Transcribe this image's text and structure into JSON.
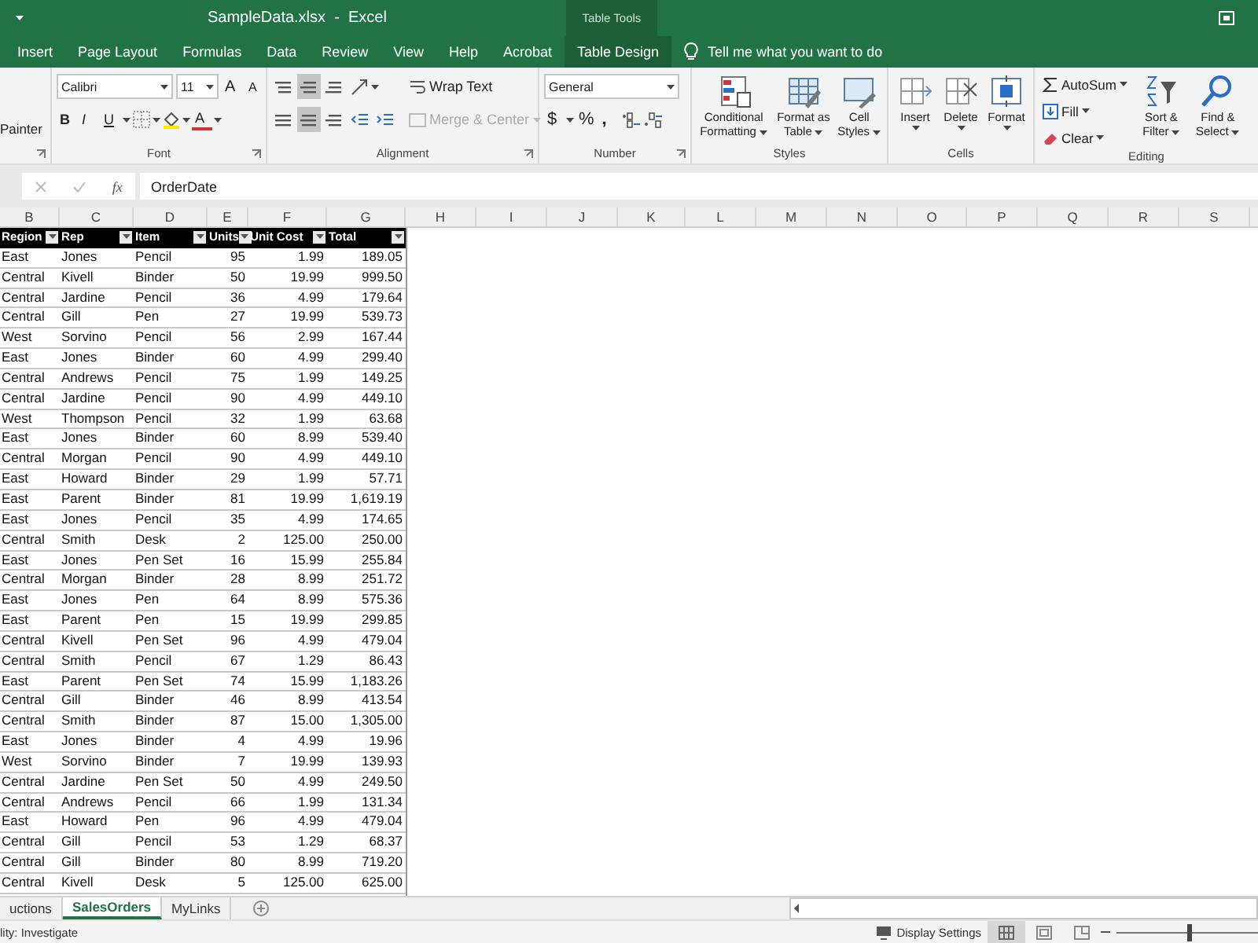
{
  "title_bar": {
    "title": "SampleData.xlsx  -  Excel",
    "context_label": "Table Tools"
  },
  "ribbon_tabs": [
    {
      "label": "Insert",
      "kind": "standard"
    },
    {
      "label": "Page Layout",
      "kind": "standard"
    },
    {
      "label": "Formulas",
      "kind": "standard"
    },
    {
      "label": "Data",
      "kind": "standard"
    },
    {
      "label": "Review",
      "kind": "standard"
    },
    {
      "label": "View",
      "kind": "standard"
    },
    {
      "label": "Help",
      "kind": "standard"
    },
    {
      "label": "Acrobat",
      "kind": "standard"
    },
    {
      "label": "Table Design",
      "kind": "contextual"
    }
  ],
  "tell_me": "Tell me what you want to do",
  "ribbon": {
    "clipboard": {
      "painter": "Painter"
    },
    "font": {
      "label": "Font",
      "font_name": "Calibri",
      "font_size": "11",
      "size_buttons": [
        "A",
        "A"
      ],
      "style_buttons": [
        "B",
        "I",
        "U"
      ],
      "font_color_button": "A"
    },
    "alignment": {
      "label": "Alignment",
      "wrap_text": {
        "label": "Wrap Text",
        "disabled": false
      },
      "merge": {
        "label": "Merge & Center",
        "disabled": true
      }
    },
    "number": {
      "label": "Number",
      "format": "General",
      "symbols": [
        "$",
        "%",
        ","
      ]
    },
    "styles": {
      "label": "Styles",
      "buttons": [
        "Conditional Formatting",
        "Format as Table",
        "Cell Styles"
      ]
    },
    "cells": {
      "label": "Cells",
      "buttons": [
        "Insert",
        "Delete",
        "Format"
      ]
    },
    "editing": {
      "label": "Editing",
      "small_buttons": [
        "AutoSum",
        "Fill",
        "Clear"
      ],
      "large_buttons": [
        "Sort & Filter",
        "Find & Select"
      ]
    }
  },
  "formula_bar": {
    "function_label": "fx",
    "content": "OrderDate"
  },
  "columns": [
    "B",
    "C",
    "D",
    "E",
    "F",
    "G",
    "H",
    "I",
    "J",
    "K",
    "L",
    "M",
    "N",
    "O",
    "P",
    "Q",
    "R",
    "S"
  ],
  "table": {
    "headers": [
      {
        "label": "Region",
        "kind": "text"
      },
      {
        "label": "Rep",
        "kind": "text"
      },
      {
        "label": "Item",
        "kind": "text"
      },
      {
        "label": "Units",
        "kind": "number"
      },
      {
        "label": "Unit Cost",
        "kind": "number"
      },
      {
        "label": "Total",
        "kind": "number"
      }
    ],
    "rows": [
      [
        "East",
        "Jones",
        "Pencil",
        "95",
        "1.99",
        "189.05"
      ],
      [
        "Central",
        "Kivell",
        "Binder",
        "50",
        "19.99",
        "999.50"
      ],
      [
        "Central",
        "Jardine",
        "Pencil",
        "36",
        "4.99",
        "179.64"
      ],
      [
        "Central",
        "Gill",
        "Pen",
        "27",
        "19.99",
        "539.73"
      ],
      [
        "West",
        "Sorvino",
        "Pencil",
        "56",
        "2.99",
        "167.44"
      ],
      [
        "East",
        "Jones",
        "Binder",
        "60",
        "4.99",
        "299.40"
      ],
      [
        "Central",
        "Andrews",
        "Pencil",
        "75",
        "1.99",
        "149.25"
      ],
      [
        "Central",
        "Jardine",
        "Pencil",
        "90",
        "4.99",
        "449.10"
      ],
      [
        "West",
        "Thompson",
        "Pencil",
        "32",
        "1.99",
        "63.68"
      ],
      [
        "East",
        "Jones",
        "Binder",
        "60",
        "8.99",
        "539.40"
      ],
      [
        "Central",
        "Morgan",
        "Pencil",
        "90",
        "4.99",
        "449.10"
      ],
      [
        "East",
        "Howard",
        "Binder",
        "29",
        "1.99",
        "57.71"
      ],
      [
        "East",
        "Parent",
        "Binder",
        "81",
        "19.99",
        "1,619.19"
      ],
      [
        "East",
        "Jones",
        "Pencil",
        "35",
        "4.99",
        "174.65"
      ],
      [
        "Central",
        "Smith",
        "Desk",
        "2",
        "125.00",
        "250.00"
      ],
      [
        "East",
        "Jones",
        "Pen Set",
        "16",
        "15.99",
        "255.84"
      ],
      [
        "Central",
        "Morgan",
        "Binder",
        "28",
        "8.99",
        "251.72"
      ],
      [
        "East",
        "Jones",
        "Pen",
        "64",
        "8.99",
        "575.36"
      ],
      [
        "East",
        "Parent",
        "Pen",
        "15",
        "19.99",
        "299.85"
      ],
      [
        "Central",
        "Kivell",
        "Pen Set",
        "96",
        "4.99",
        "479.04"
      ],
      [
        "Central",
        "Smith",
        "Pencil",
        "67",
        "1.29",
        "86.43"
      ],
      [
        "East",
        "Parent",
        "Pen Set",
        "74",
        "15.99",
        "1,183.26"
      ],
      [
        "Central",
        "Gill",
        "Binder",
        "46",
        "8.99",
        "413.54"
      ],
      [
        "Central",
        "Smith",
        "Binder",
        "87",
        "15.00",
        "1,305.00"
      ],
      [
        "East",
        "Jones",
        "Binder",
        "4",
        "4.99",
        "19.96"
      ],
      [
        "West",
        "Sorvino",
        "Binder",
        "7",
        "19.99",
        "139.93"
      ],
      [
        "Central",
        "Jardine",
        "Pen Set",
        "50",
        "4.99",
        "249.50"
      ],
      [
        "Central",
        "Andrews",
        "Pencil",
        "66",
        "1.99",
        "131.34"
      ],
      [
        "East",
        "Howard",
        "Pen",
        "96",
        "4.99",
        "479.04"
      ],
      [
        "Central",
        "Gill",
        "Pencil",
        "53",
        "1.29",
        "68.37"
      ],
      [
        "Central",
        "Gill",
        "Binder",
        "80",
        "8.99",
        "719.20"
      ],
      [
        "Central",
        "Kivell",
        "Desk",
        "5",
        "125.00",
        "625.00"
      ]
    ]
  },
  "sheet_tabs": [
    {
      "label": "uctions",
      "selected": false
    },
    {
      "label": "SalesOrders",
      "selected": true
    },
    {
      "label": "MyLinks",
      "selected": false
    }
  ],
  "status_bar": {
    "message": "lity: Investigate",
    "display_settings": "Display Settings",
    "zoom": {
      "level": 0.5
    }
  }
}
